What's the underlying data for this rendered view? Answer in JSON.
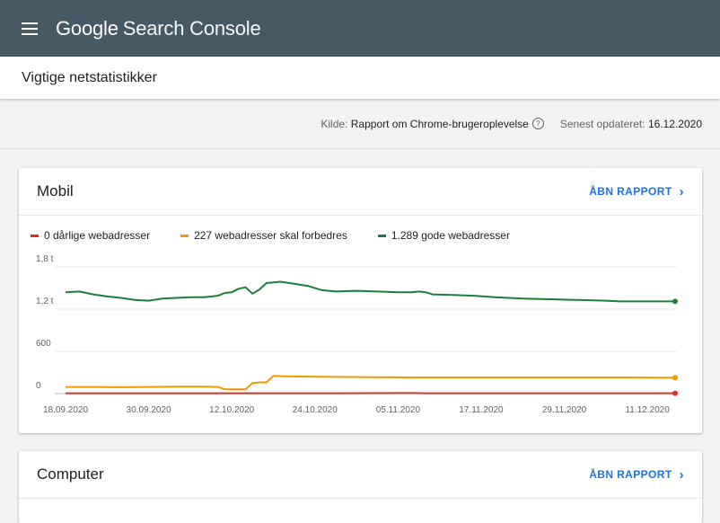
{
  "app": {
    "brand_google": "Google",
    "brand_product": "Search Console"
  },
  "page": {
    "title": "Vigtige netstatistikker"
  },
  "meta": {
    "source_label": "Kilde:",
    "source_value": "Rapport om Chrome-brugeroplevelse",
    "updated_label": "Senest opdateret:",
    "updated_value": "16.12.2020"
  },
  "cards": {
    "mobil": {
      "title": "Mobil",
      "open_label": "ÅBN RAPPORT"
    },
    "computer": {
      "title": "Computer",
      "open_label": "ÅBN RAPPORT"
    }
  },
  "colors": {
    "poor": "#d93025",
    "improve": "#f29900",
    "good": "#188038",
    "appbar": "#455a64",
    "link": "#1a73e8"
  },
  "chart_data": {
    "type": "line",
    "title": "",
    "xlabel": "",
    "ylabel": "",
    "ylim": [
      0,
      1800
    ],
    "grid": true,
    "legend_position": "top-left",
    "y_ticks": [
      {
        "value": 0,
        "label": "0"
      },
      {
        "value": 600,
        "label": "600"
      },
      {
        "value": 1200,
        "label": "1,2 t"
      },
      {
        "value": 1800,
        "label": "1,8 t"
      }
    ],
    "x_ticks": [
      "18.09.2020",
      "30.09.2020",
      "12.10.2020",
      "24.10.2020",
      "05.11.2020",
      "17.11.2020",
      "29.11.2020",
      "11.12.2020"
    ],
    "x_tick_days": [
      0,
      12,
      24,
      36,
      48,
      60,
      72,
      84
    ],
    "x_day_span": [
      0,
      88
    ],
    "series": [
      {
        "name": "1.289 gode webadresser",
        "color": "#188038",
        "points": [
          [
            0,
            1440
          ],
          [
            2,
            1450
          ],
          [
            4,
            1410
          ],
          [
            6,
            1380
          ],
          [
            8,
            1360
          ],
          [
            10,
            1330
          ],
          [
            12,
            1320
          ],
          [
            14,
            1350
          ],
          [
            16,
            1360
          ],
          [
            18,
            1370
          ],
          [
            20,
            1370
          ],
          [
            22,
            1390
          ],
          [
            23,
            1430
          ],
          [
            24,
            1440
          ],
          [
            25,
            1490
          ],
          [
            26,
            1510
          ],
          [
            27,
            1420
          ],
          [
            28,
            1480
          ],
          [
            29,
            1570
          ],
          [
            31,
            1590
          ],
          [
            33,
            1560
          ],
          [
            35,
            1530
          ],
          [
            37,
            1470
          ],
          [
            39,
            1450
          ],
          [
            42,
            1460
          ],
          [
            45,
            1450
          ],
          [
            48,
            1440
          ],
          [
            50,
            1440
          ],
          [
            51,
            1450
          ],
          [
            52,
            1440
          ],
          [
            53,
            1410
          ],
          [
            56,
            1400
          ],
          [
            59,
            1390
          ],
          [
            62,
            1370
          ],
          [
            66,
            1350
          ],
          [
            70,
            1340
          ],
          [
            74,
            1330
          ],
          [
            78,
            1320
          ],
          [
            80,
            1310
          ],
          [
            84,
            1310
          ],
          [
            86,
            1310
          ],
          [
            88,
            1310
          ]
        ]
      },
      {
        "name": "227 webadresser skal forbedres",
        "color": "#f29900",
        "points": [
          [
            0,
            95
          ],
          [
            4,
            95
          ],
          [
            8,
            90
          ],
          [
            12,
            95
          ],
          [
            16,
            100
          ],
          [
            20,
            100
          ],
          [
            22,
            95
          ],
          [
            23,
            60
          ],
          [
            25,
            60
          ],
          [
            26,
            60
          ],
          [
            27,
            150
          ],
          [
            28,
            160
          ],
          [
            29,
            160
          ],
          [
            30,
            250
          ],
          [
            32,
            245
          ],
          [
            36,
            240
          ],
          [
            42,
            235
          ],
          [
            50,
            230
          ],
          [
            60,
            230
          ],
          [
            70,
            230
          ],
          [
            80,
            230
          ],
          [
            88,
            225
          ]
        ]
      },
      {
        "name": "0 dårlige webadresser",
        "color": "#d93025",
        "points": [
          [
            0,
            5
          ],
          [
            20,
            5
          ],
          [
            40,
            5
          ],
          [
            50,
            8
          ],
          [
            52,
            5
          ],
          [
            70,
            5
          ],
          [
            88,
            5
          ]
        ]
      }
    ]
  }
}
